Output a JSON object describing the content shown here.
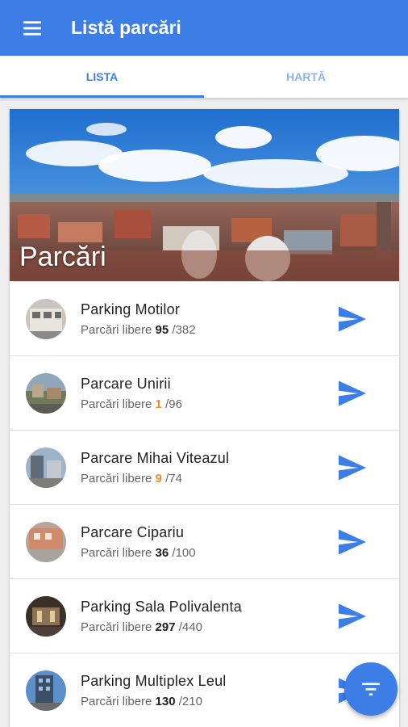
{
  "appbar": {
    "title": "Listă parcări",
    "menu_icon": "menu-icon"
  },
  "tabs": [
    {
      "label": "LISTA",
      "active": true
    },
    {
      "label": "HARTĂ",
      "active": false
    }
  ],
  "hero": {
    "title": "Parcări"
  },
  "parkings": [
    {
      "name": "Parking Motilor",
      "free_label": "Parcări libere",
      "free": "95",
      "total": "/382",
      "low": false
    },
    {
      "name": "Parcare Unirii",
      "free_label": "Parcări libere",
      "free": "1",
      "total": "/96",
      "low": true
    },
    {
      "name": "Parcare Mihai Viteazul",
      "free_label": "Parcări libere",
      "free": "9",
      "total": "/74",
      "low": true
    },
    {
      "name": "Parcare Cipariu",
      "free_label": "Parcări libere",
      "free": "36",
      "total": "/100",
      "low": false
    },
    {
      "name": "Parking Sala Polivalenta",
      "free_label": "Parcări libere",
      "free": "297",
      "total": "/440",
      "low": false
    },
    {
      "name": "Parking Multiplex Leul",
      "free_label": "Parcări libere",
      "free": "130",
      "total": "/210",
      "low": false
    }
  ],
  "fab": {
    "icon": "filter-icon"
  },
  "colors": {
    "primary": "#3d7de6",
    "low_availability": "#f08a2e"
  }
}
